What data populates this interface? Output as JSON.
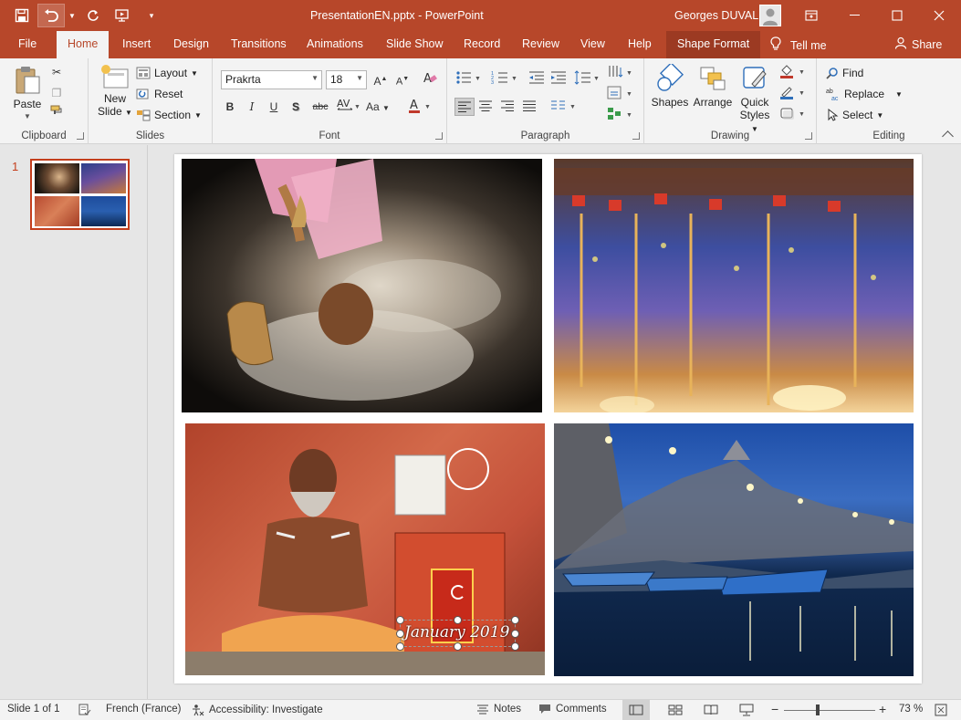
{
  "titlebar": {
    "doc_title": "PresentationEN.pptx  -  PowerPoint",
    "user_name": "Georges DUVAL",
    "colors": {
      "brand": "#b7472a"
    }
  },
  "tabs": [
    "File",
    "Home",
    "Insert",
    "Design",
    "Transitions",
    "Animations",
    "Slide Show",
    "Record",
    "Review",
    "View",
    "Help",
    "Shape Format"
  ],
  "tell_me": "Tell me",
  "share": "Share",
  "ribbon": {
    "clipboard": {
      "paste": "Paste",
      "label": "Clipboard"
    },
    "slides": {
      "new_slide_1": "New",
      "new_slide_2": "Slide",
      "layout": "Layout",
      "reset": "Reset",
      "section": "Section",
      "label": "Slides"
    },
    "font": {
      "family": "Prakrta",
      "size": "18",
      "bold": "B",
      "italic": "I",
      "underline": "U",
      "shadow": "S",
      "strike": "abc",
      "case": "Aa",
      "label": "Font"
    },
    "paragraph": {
      "label": "Paragraph"
    },
    "drawing": {
      "shapes": "Shapes",
      "arrange": "Arrange",
      "quick_1": "Quick",
      "quick_2": "Styles",
      "label": "Drawing"
    },
    "editing": {
      "find": "Find",
      "replace": "Replace",
      "select": "Select",
      "label": "Editing"
    }
  },
  "thumbs": {
    "slide_number": "1"
  },
  "slide": {
    "caption": "January 2019"
  },
  "status": {
    "slide_of": "Slide 1 of 1",
    "language": "French (France)",
    "accessibility": "Accessibility: Investigate",
    "notes": "Notes",
    "comments": "Comments",
    "zoom": "73 %"
  }
}
